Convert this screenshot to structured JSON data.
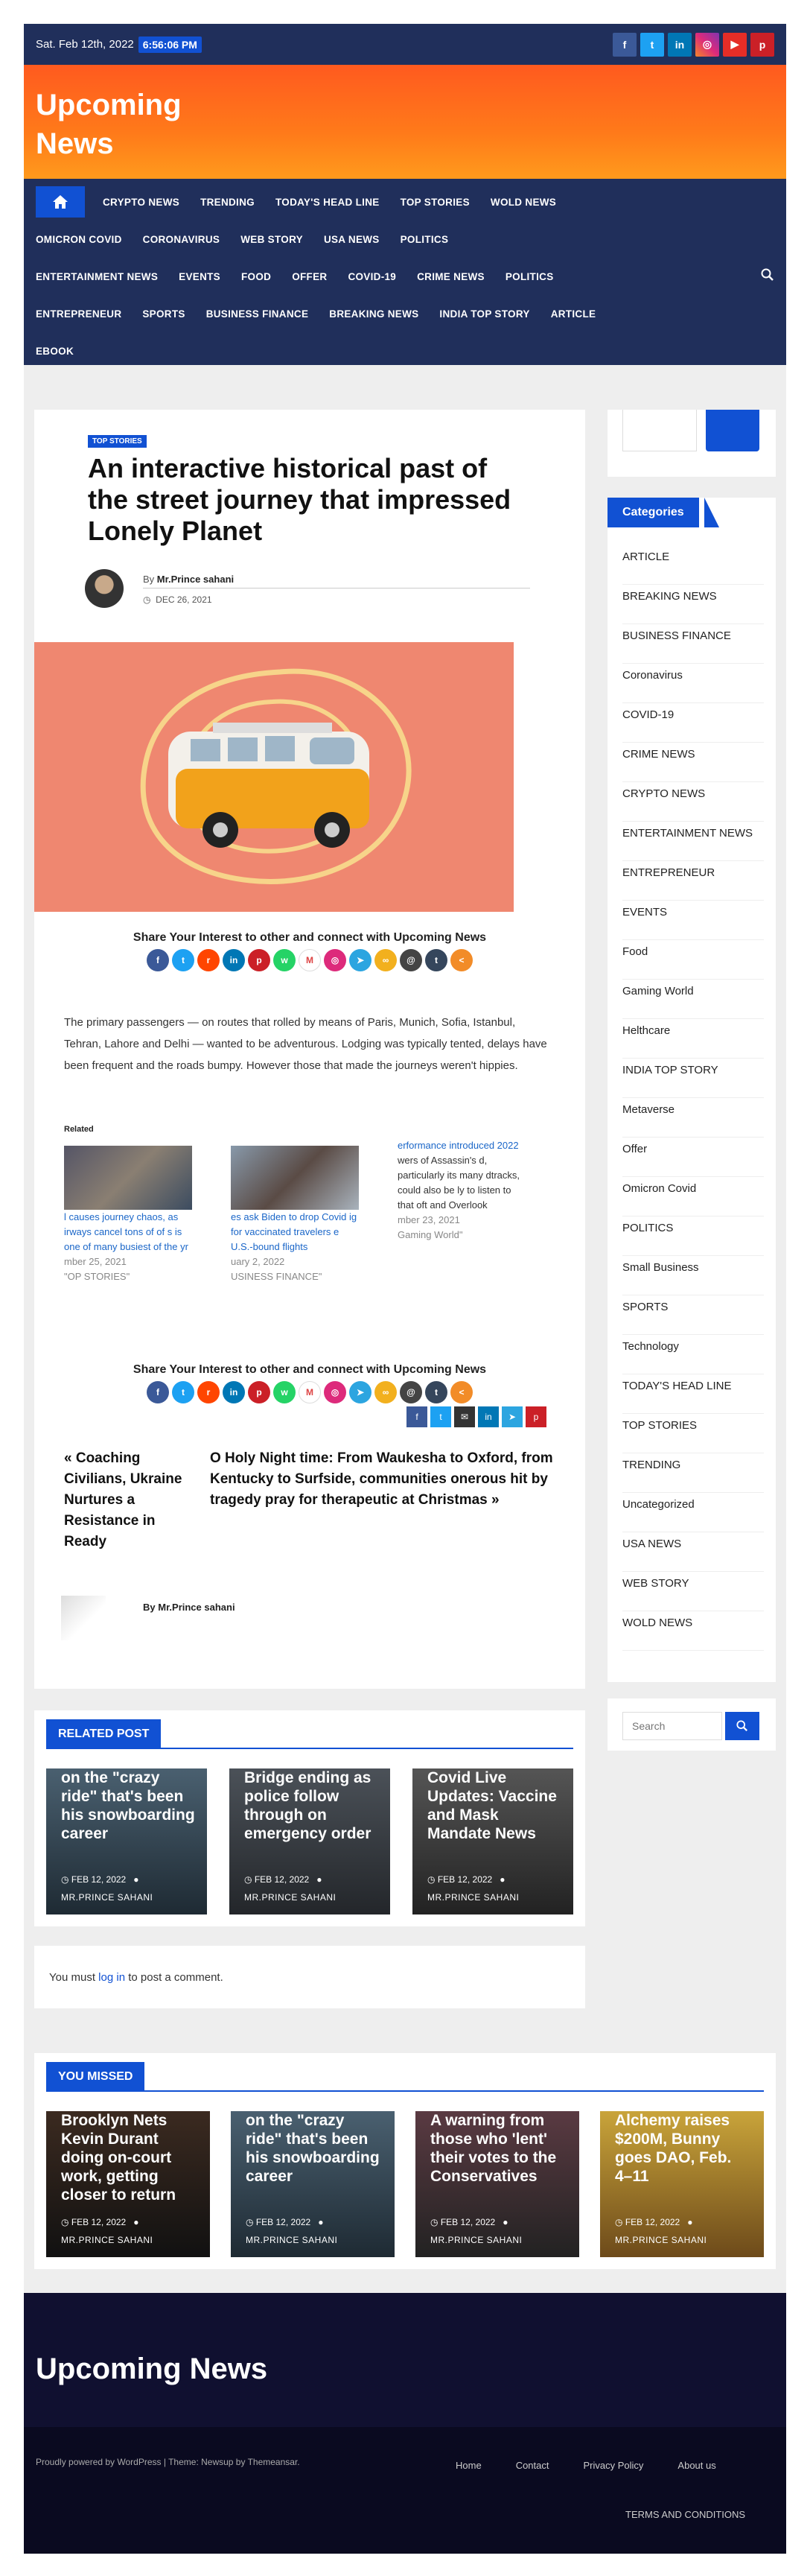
{
  "topbar": {
    "date": "Sat. Feb 12th, 2022",
    "time": "6:56:06 PM"
  },
  "site": {
    "name": "Upcoming News"
  },
  "nav": {
    "rows": [
      [
        "CRYPTO NEWS",
        "TRENDING",
        "TODAY'S HEAD LINE",
        "TOP STORIES",
        "WOLD NEWS"
      ],
      [
        "OMICRON COVID",
        "CORONAVIRUS",
        "WEB STORY",
        "USA NEWS",
        "POLITICS"
      ],
      [
        "ENTERTAINMENT NEWS",
        "EVENTS",
        "FOOD",
        "OFFER",
        "COVID-19",
        "CRIME NEWS",
        "POLITICS"
      ],
      [
        "ENTREPRENEUR",
        "SPORTS",
        "BUSINESS FINANCE",
        "BREAKING NEWS",
        "INDIA TOP STORY",
        "ARTICLE"
      ],
      [
        "EBOOK"
      ]
    ]
  },
  "post": {
    "tag": "TOP STORIES",
    "title": "An interactive historical past of the street journey that impressed Lonely Planet",
    "by": "By",
    "author": "Mr.Prince sahani",
    "date": "DEC 26, 2021",
    "share_title": "Share Your Interest to other and connect with Upcoming News",
    "body": "The primary passengers — on routes that rolled by means of Paris, Munich, Sofia, Istanbul, Tehran, Lahore and Delhi — wanted to be adventurous. Lodging was typically tented, delays have been frequent and the roads bumpy. However those that made the journeys weren't hippies.",
    "related_label": "Related",
    "related": [
      {
        "cap": "l causes journey chaos, as irways cancel tons of of s is one of many busiest of the yr",
        "date": "mber 25, 2021",
        "cat": "\"OP STORIES\""
      },
      {
        "cap": "es ask Biden to drop Covid ig for vaccinated travelers e U.S.-bound flights",
        "date": "uary 2, 2022",
        "cat": "USINESS FINANCE\""
      },
      {
        "cap": "erformance introduced 2022",
        "extra": "wers of Assassin's d, particularly its many dtracks, could also be ly to listen to that oft and Overlook",
        "date": "mber 23, 2021",
        "cat": "Gaming World\""
      }
    ],
    "prev": "« Coaching Civilians, Ukraine Nurtures a Resistance in Ready",
    "next": "O Holy Night time: From Waukesha to Oxford, from Kentucky to Surfside, communities onerous hit by tragedy pray for therapeutic at Christmas »",
    "author_box": "Mr.Prince sahani"
  },
  "sidebar": {
    "categories_title": "Categories",
    "categories": [
      "ARTICLE",
      "BREAKING NEWS",
      "BUSINESS FINANCE",
      "Coronavirus",
      "COVID-19",
      "CRIME NEWS",
      "CRYPTO NEWS",
      "ENTERTAINMENT NEWS",
      "ENTREPRENEUR",
      "EVENTS",
      "Food",
      "Gaming World",
      "Helthcare",
      "INDIA TOP STORY",
      "Metaverse",
      "Offer",
      "Omicron Covid",
      "POLITICS",
      "Small Business",
      "SPORTS",
      "Technology",
      "TODAY'S HEAD LINE",
      "TOP STORIES",
      "TRENDING",
      "Uncategorized",
      "USA NEWS",
      "WEB STORY",
      "WOLD NEWS"
    ],
    "search_placeholder": "Search"
  },
  "related_post": {
    "title": "RELATED POST",
    "items": [
      {
        "title": "on the \"crazy ride\" that's been his snowboarding career",
        "date": "FEB 12, 2022",
        "author": "MR.PRINCE SAHANI"
      },
      {
        "title": "Bridge ending as police follow through on emergency order",
        "date": "FEB 12, 2022",
        "author": "MR.PRINCE SAHANI"
      },
      {
        "title": "Covid Live Updates: Vaccine and Mask Mandate News",
        "date": "FEB 12, 2022",
        "author": "MR.PRINCE SAHANI"
      }
    ]
  },
  "comment": {
    "pre": "You must ",
    "link": "log in",
    "post": " to post a comment."
  },
  "missed": {
    "title": "YOU MISSED",
    "items": [
      {
        "title": "Brooklyn Nets Kevin Durant doing on-court work, getting closer to return",
        "date": "FEB 12, 2022",
        "author": "MR.PRINCE SAHANI"
      },
      {
        "title": "on the \"crazy ride\" that's been his snowboarding career",
        "date": "FEB 12, 2022",
        "author": "MR.PRINCE SAHANI"
      },
      {
        "title": "A warning from those who 'lent' their votes to the Conservatives",
        "date": "FEB 12, 2022",
        "author": "MR.PRINCE SAHANI"
      },
      {
        "title": "Alchemy raises $200M, Bunny goes DAO, Feb. 4–11",
        "date": "FEB 12, 2022",
        "author": "MR.PRINCE SAHANI"
      }
    ]
  },
  "footer": {
    "brand": "Upcoming News",
    "powered": "Proudly powered by WordPress | Theme: Newsup by Themeansar.",
    "links": [
      "Home",
      "Contact",
      "Privacy Policy",
      "About us"
    ],
    "terms": "TERMS AND CONDITIONS"
  },
  "colors": {
    "navy": "#202f5b",
    "accent": "#1151d3",
    "orange": "#ff6a1a",
    "footer": "#101030"
  }
}
